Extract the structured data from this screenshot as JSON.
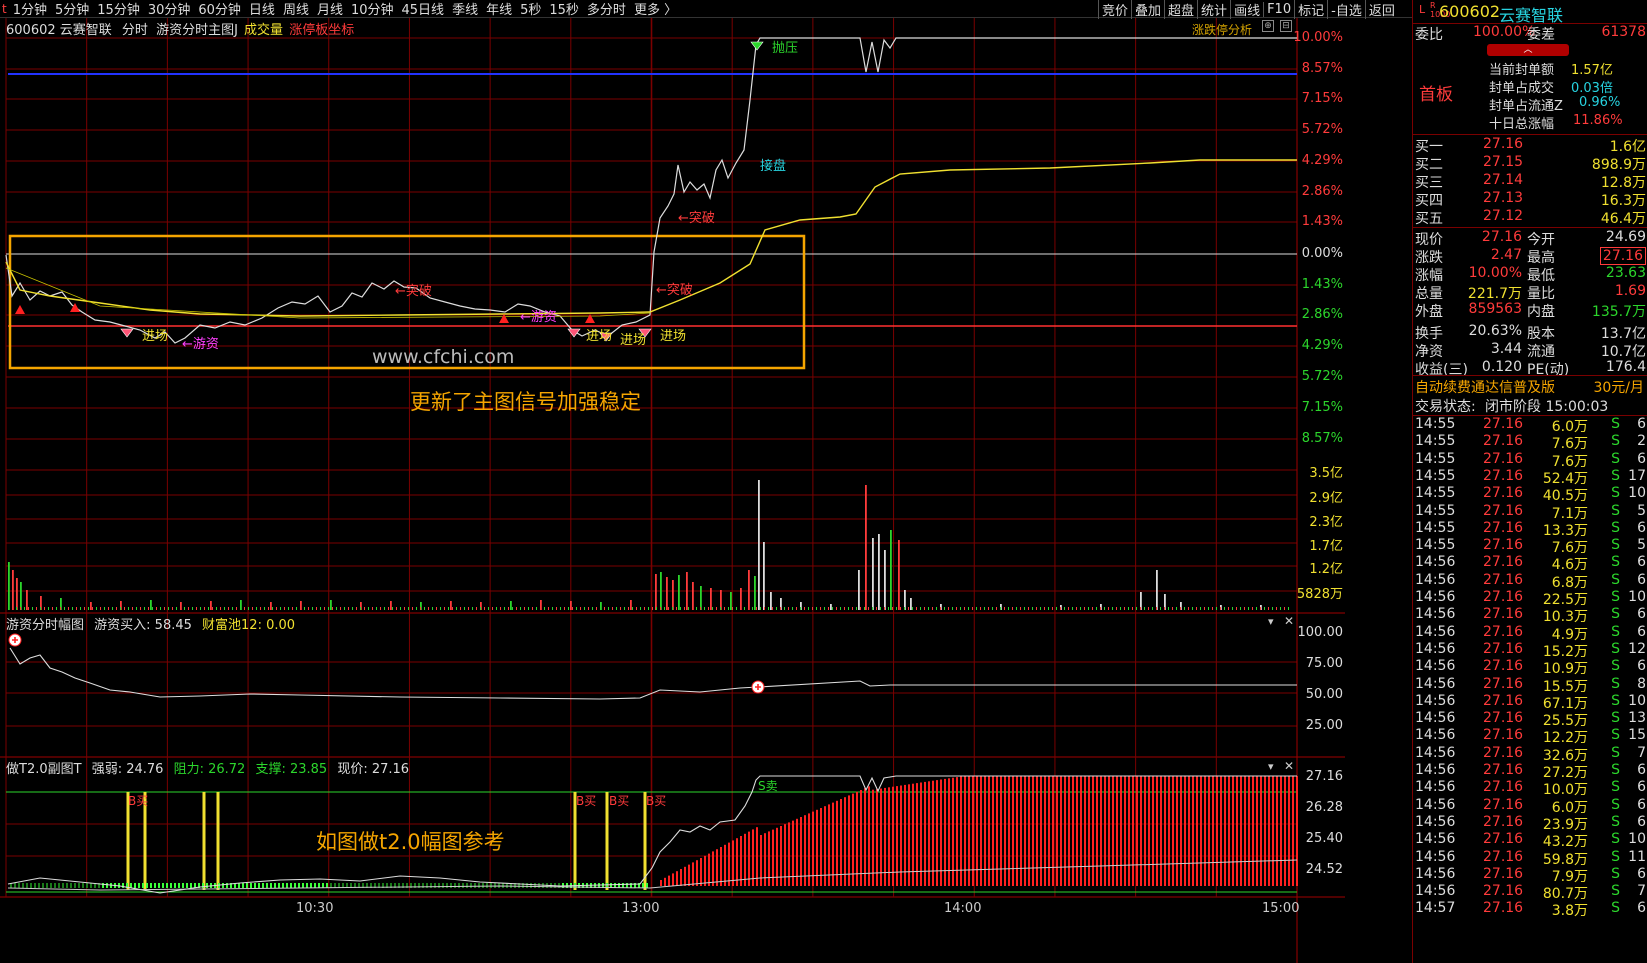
{
  "top_menu": {
    "periods": [
      "1分钟",
      "5分钟",
      "15分钟",
      "30分钟",
      "60分钟",
      "日线",
      "周线",
      "月线",
      "10分钟",
      "45日线",
      "季线",
      "年线",
      "5秒",
      "15秒",
      "多分时",
      "更多 〉"
    ],
    "right": [
      "竞价",
      "叠加",
      "超盘",
      "统计",
      "画线",
      "F10",
      "标记",
      "-自选",
      "返回"
    ]
  },
  "main_header": {
    "code_name": "600602 云赛智联",
    "item1": "分时",
    "item2": "游资分时主图J",
    "item3": "成交量",
    "item4": "涨停板坐标",
    "right_btn": "涨跌停分析"
  },
  "price_axis": [
    "10.00%",
    "8.57%",
    "7.15%",
    "5.72%",
    "4.29%",
    "2.86%",
    "1.43%",
    "0.00%",
    "1.43%",
    "2.86%",
    "4.29%",
    "5.72%",
    "7.15%",
    "8.57%"
  ],
  "volume_axis": [
    "3.5亿",
    "2.9亿",
    "2.3亿",
    "1.7亿",
    "1.2亿",
    "5828万"
  ],
  "annotations": {
    "watermark": "www.cfchi.com",
    "note_main": "更新了主图信号加强稳定",
    "note_sub": "如图做t2.0幅图参考",
    "pressure": "抛压",
    "breakout": "←突破",
    "youzi": "←游资",
    "enter": "进场",
    "jiepan": "接盘"
  },
  "sub1": {
    "title": "游资分时幅图",
    "buy_label": "游资买入: 58.45",
    "pool_label": "财富池12: 0.00",
    "axis": [
      "100.00",
      "75.00",
      "50.00",
      "25.00"
    ]
  },
  "sub2": {
    "title": "做T2.0副图T",
    "strength": "强弱: 24.76",
    "resist": "阻力: 26.72",
    "support": "支撑: 23.85",
    "price": "现价: 27.16",
    "axis": [
      "27.16",
      "26.28",
      "25.40",
      "24.52"
    ],
    "buy": "B买",
    "sell": "S卖"
  },
  "time_axis": [
    "10:30",
    "13:00",
    "14:00",
    "15:00"
  ],
  "right_panel": {
    "code": "600602",
    "name": "云赛智联",
    "weibi_label": "委比",
    "weibi_val": "100.00%",
    "weicha_label": "委差",
    "weicha_val": "61378",
    "board": "首板",
    "seal_amount_label": "当前封单额",
    "seal_amount": "1.57亿",
    "seal_vol_label": "封单占成交",
    "seal_vol": "0.03倍",
    "seal_float_label": "封单占流通Z",
    "seal_float": "0.96%",
    "ten_day_label": "十日总涨幅",
    "ten_day": "11.86%",
    "bids": [
      {
        "label": "买一",
        "price": "27.16",
        "vol": "1.6亿"
      },
      {
        "label": "买二",
        "price": "27.15",
        "vol": "898.9万"
      },
      {
        "label": "买三",
        "price": "27.14",
        "vol": "12.8万"
      },
      {
        "label": "买四",
        "price": "27.13",
        "vol": "16.3万"
      },
      {
        "label": "买五",
        "price": "27.12",
        "vol": "46.4万"
      }
    ],
    "quote": [
      {
        "l1": "现价",
        "v1": "27.16",
        "l2": "今开",
        "v2": "24.69"
      },
      {
        "l1": "涨跌",
        "v1": "2.47",
        "l2": "最高",
        "v2": "27.16"
      },
      {
        "l1": "涨幅",
        "v1": "10.00%",
        "l2": "最低",
        "v2": "23.63"
      },
      {
        "l1": "总量",
        "v1": "221.7万",
        "l2": "量比",
        "v2": "1.69"
      },
      {
        "l1": "外盘",
        "v1": "859563",
        "l2": "内盘",
        "v2": "135.7万"
      },
      {
        "l1": "换手",
        "v1": "20.63%",
        "l2": "股本",
        "v2": "13.7亿"
      },
      {
        "l1": "净资",
        "v1": "3.44",
        "l2": "流通",
        "v2": "10.7亿"
      },
      {
        "l1": "收益(三)",
        "v1": "0.120",
        "l2": "PE(动)",
        "v2": "176.4"
      }
    ],
    "ad": "自动续费通达信普及版",
    "ad_price": "30元/月",
    "status_label": "交易状态:",
    "status_val": "闭市阶段 15:00:03",
    "ticks": [
      [
        "14:55",
        "27.16",
        "6.0万",
        "S",
        "6"
      ],
      [
        "14:55",
        "27.16",
        "7.6万",
        "S",
        "2"
      ],
      [
        "14:55",
        "27.16",
        "7.6万",
        "S",
        "6"
      ],
      [
        "14:55",
        "27.16",
        "52.4万",
        "S",
        "17"
      ],
      [
        "14:55",
        "27.16",
        "40.5万",
        "S",
        "10"
      ],
      [
        "14:55",
        "27.16",
        "7.1万",
        "S",
        "5"
      ],
      [
        "14:55",
        "27.16",
        "13.3万",
        "S",
        "6"
      ],
      [
        "14:55",
        "27.16",
        "7.6万",
        "S",
        "5"
      ],
      [
        "14:56",
        "27.16",
        "4.6万",
        "S",
        "6"
      ],
      [
        "14:56",
        "27.16",
        "6.8万",
        "S",
        "6"
      ],
      [
        "14:56",
        "27.16",
        "22.5万",
        "S",
        "10"
      ],
      [
        "14:56",
        "27.16",
        "10.3万",
        "S",
        "6"
      ],
      [
        "14:56",
        "27.16",
        "4.9万",
        "S",
        "6"
      ],
      [
        "14:56",
        "27.16",
        "15.2万",
        "S",
        "12"
      ],
      [
        "14:56",
        "27.16",
        "10.9万",
        "S",
        "6"
      ],
      [
        "14:56",
        "27.16",
        "15.5万",
        "S",
        "8"
      ],
      [
        "14:56",
        "27.16",
        "67.1万",
        "S",
        "10"
      ],
      [
        "14:56",
        "27.16",
        "25.5万",
        "S",
        "13"
      ],
      [
        "14:56",
        "27.16",
        "12.2万",
        "S",
        "15"
      ],
      [
        "14:56",
        "27.16",
        "32.6万",
        "S",
        "7"
      ],
      [
        "14:56",
        "27.16",
        "27.2万",
        "S",
        "6"
      ],
      [
        "14:56",
        "27.16",
        "10.0万",
        "S",
        "6"
      ],
      [
        "14:56",
        "27.16",
        "6.0万",
        "S",
        "6"
      ],
      [
        "14:56",
        "27.16",
        "23.9万",
        "S",
        "6"
      ],
      [
        "14:56",
        "27.16",
        "43.2万",
        "S",
        "10"
      ],
      [
        "14:56",
        "27.16",
        "59.8万",
        "S",
        "11"
      ],
      [
        "14:56",
        "27.16",
        "7.9万",
        "S",
        "6"
      ],
      [
        "14:56",
        "27.16",
        "80.7万",
        "S",
        "7"
      ],
      [
        "14:57",
        "27.16",
        "3.8万",
        "S",
        "6"
      ]
    ]
  },
  "colors": {
    "red": "#ff3b3b",
    "green": "#2cd62c",
    "yellow": "#f0e030",
    "cyan": "#27d3e0",
    "orange": "#f5a500",
    "magenta": "#ff40ff",
    "blue": "#2233ff",
    "grid": "#7a0000"
  }
}
